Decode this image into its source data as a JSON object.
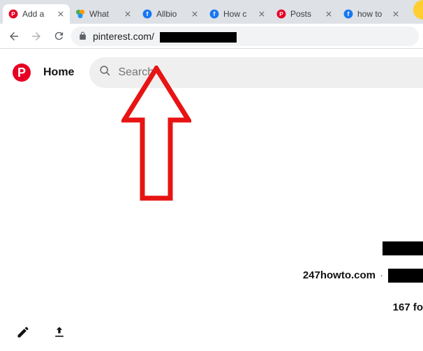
{
  "browser": {
    "tabs": [
      {
        "title": "Add a"
      },
      {
        "title": "What"
      },
      {
        "title": "Allbio"
      },
      {
        "title": "How c"
      },
      {
        "title": "Posts"
      },
      {
        "title": "how to"
      }
    ],
    "url_visible": "pinterest.com/"
  },
  "app": {
    "home_label": "Home",
    "search_placeholder": "Search",
    "logo_letter": "P"
  },
  "profile": {
    "site": "247howto.com",
    "separator": "·",
    "followers_partial": "167 fo"
  }
}
